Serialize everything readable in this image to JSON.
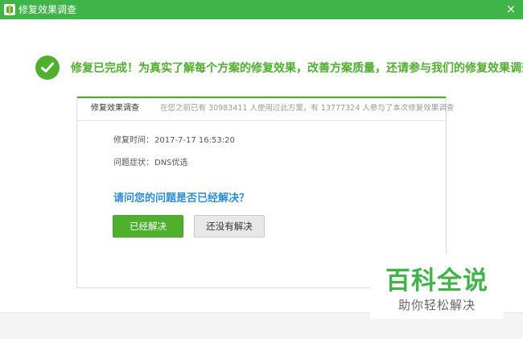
{
  "window": {
    "title": "修复效果调查",
    "close_glyph": "×"
  },
  "headline": {
    "text": "修复已完成！为真实了解每个方案的修复效果，改善方案质量，还请参与我们的修复效果调查！"
  },
  "survey": {
    "header_title": "修复效果调查",
    "header_stats": "在您之前已有 30983411 人使用过此方案，有 13777324 人参与了本次修复效果调查",
    "fields": [
      {
        "label": "修复时间：",
        "value": "2017-7-17 16:53:20"
      },
      {
        "label": "问题症状：",
        "value": "DNS优选"
      }
    ],
    "question": "请问您的问题是否已经解决？",
    "buttons": {
      "solved": "已经解决",
      "unsolved": "还没有解决"
    }
  },
  "watermark": {
    "main": "百科全说",
    "sub": "助你轻松解决"
  },
  "colors": {
    "brand_green": "#3fb449",
    "question_blue": "#2a8ce0"
  }
}
